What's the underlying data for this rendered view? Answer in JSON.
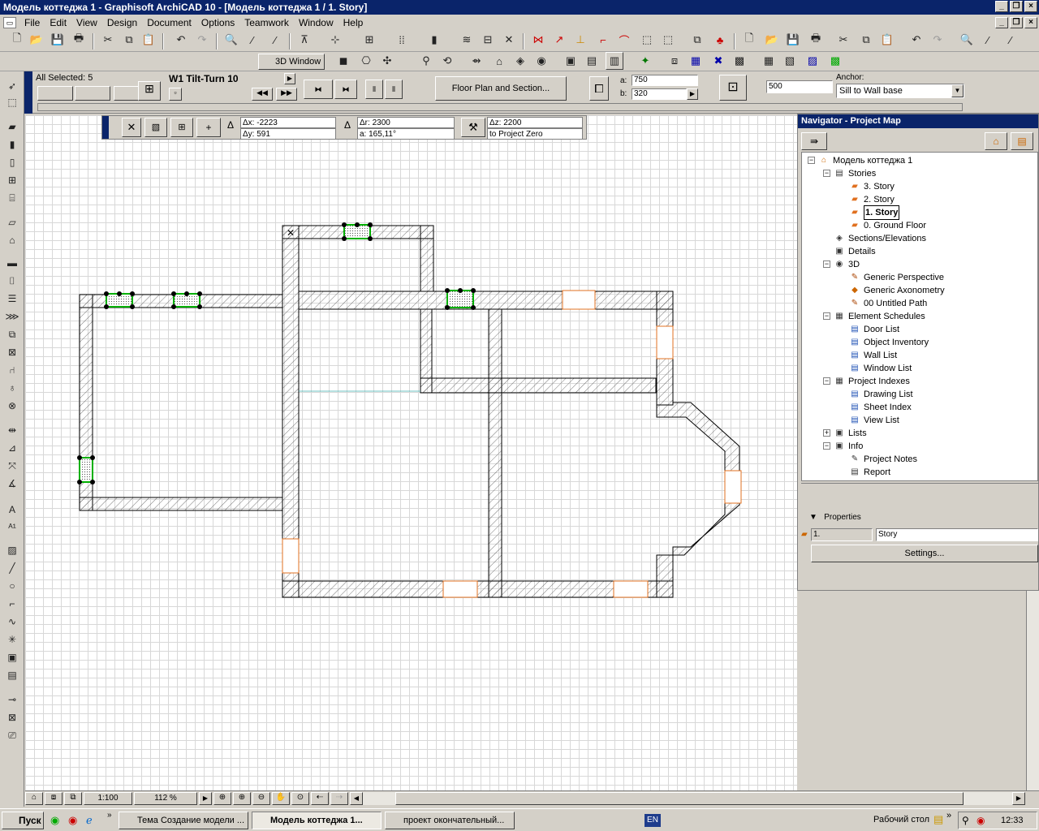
{
  "window": {
    "title": "Модель коттеджа 1 - Graphisoft ArchiCAD 10 - [Модель коттеджа 1 / 1. Story]"
  },
  "menu": [
    "File",
    "Edit",
    "View",
    "Design",
    "Document",
    "Options",
    "Teamwork",
    "Window",
    "Help"
  ],
  "infobox": {
    "selection": "All Selected: 5",
    "element_name": "W1 Tilt-Turn 10",
    "floorplan_button": "Floor Plan and Section...",
    "a_label": "a:",
    "a_value": "750",
    "b_label": "b:",
    "b_value": "320",
    "height_value": "500",
    "anchor_label": "Anchor:",
    "anchor_value": "Sill to Wall base",
    "window3d_label": "3D Window"
  },
  "coords": {
    "dx": "Δx: -2223",
    "dy": "Δy: 591",
    "dr": "Δr: 2300",
    "angle": "a:  165,11°",
    "dz": "Δz: 2200",
    "zref": "to Project Zero"
  },
  "navigator": {
    "title": "Navigator - Project Map",
    "items": [
      {
        "label": "Модель коттеджа 1",
        "level": 0,
        "icon": "house-icon"
      },
      {
        "label": "Stories",
        "level": 1,
        "icon": "stories-icon"
      },
      {
        "label": "3. Story",
        "level": 2,
        "icon": "story-icon"
      },
      {
        "label": "2. Story",
        "level": 2,
        "icon": "story-icon"
      },
      {
        "label": "1. Story",
        "level": 2,
        "icon": "story-icon",
        "selected": true
      },
      {
        "label": "0. Ground Floor",
        "level": 2,
        "icon": "story-icon"
      },
      {
        "label": "Sections/Elevations",
        "level": 1,
        "icon": "section-icon"
      },
      {
        "label": "Details",
        "level": 1,
        "icon": "details-icon"
      },
      {
        "label": "3D",
        "level": 1,
        "icon": "3d-icon"
      },
      {
        "label": "Generic Perspective",
        "level": 2,
        "icon": "camera-icon"
      },
      {
        "label": "Generic Axonometry",
        "level": 2,
        "icon": "cube-icon"
      },
      {
        "label": "00 Untitled Path",
        "level": 2,
        "icon": "path-icon"
      },
      {
        "label": "Element Schedules",
        "level": 1,
        "icon": "schedule-icon"
      },
      {
        "label": "Door List",
        "level": 2,
        "icon": "list-icon"
      },
      {
        "label": "Object Inventory",
        "level": 2,
        "icon": "list-icon"
      },
      {
        "label": "Wall List",
        "level": 2,
        "icon": "list-icon"
      },
      {
        "label": "Window List",
        "level": 2,
        "icon": "list-icon"
      },
      {
        "label": "Project Indexes",
        "level": 1,
        "icon": "index-icon"
      },
      {
        "label": "Drawing List",
        "level": 2,
        "icon": "list-icon"
      },
      {
        "label": "Sheet Index",
        "level": 2,
        "icon": "list-icon"
      },
      {
        "label": "View List",
        "level": 2,
        "icon": "list-icon"
      },
      {
        "label": "Lists",
        "level": 1,
        "icon": "lists-icon"
      },
      {
        "label": "Info",
        "level": 1,
        "icon": "info-icon"
      },
      {
        "label": "Project Notes",
        "level": 2,
        "icon": "notes-icon"
      },
      {
        "label": "Report",
        "level": 2,
        "icon": "report-icon"
      }
    ],
    "properties_label": "Properties",
    "prop_id": "1.",
    "prop_name": "Story",
    "settings_button": "Settings..."
  },
  "status": {
    "scale": "1:100",
    "zoom": "112 %"
  },
  "taskbar": {
    "start": "Пуск",
    "tasks": [
      "Тема Создание модели ...",
      "Модель коттеджа 1...",
      "проект окончательный..."
    ],
    "lang": "EN",
    "desktop": "Рабочий стол",
    "clock": "12:33"
  }
}
